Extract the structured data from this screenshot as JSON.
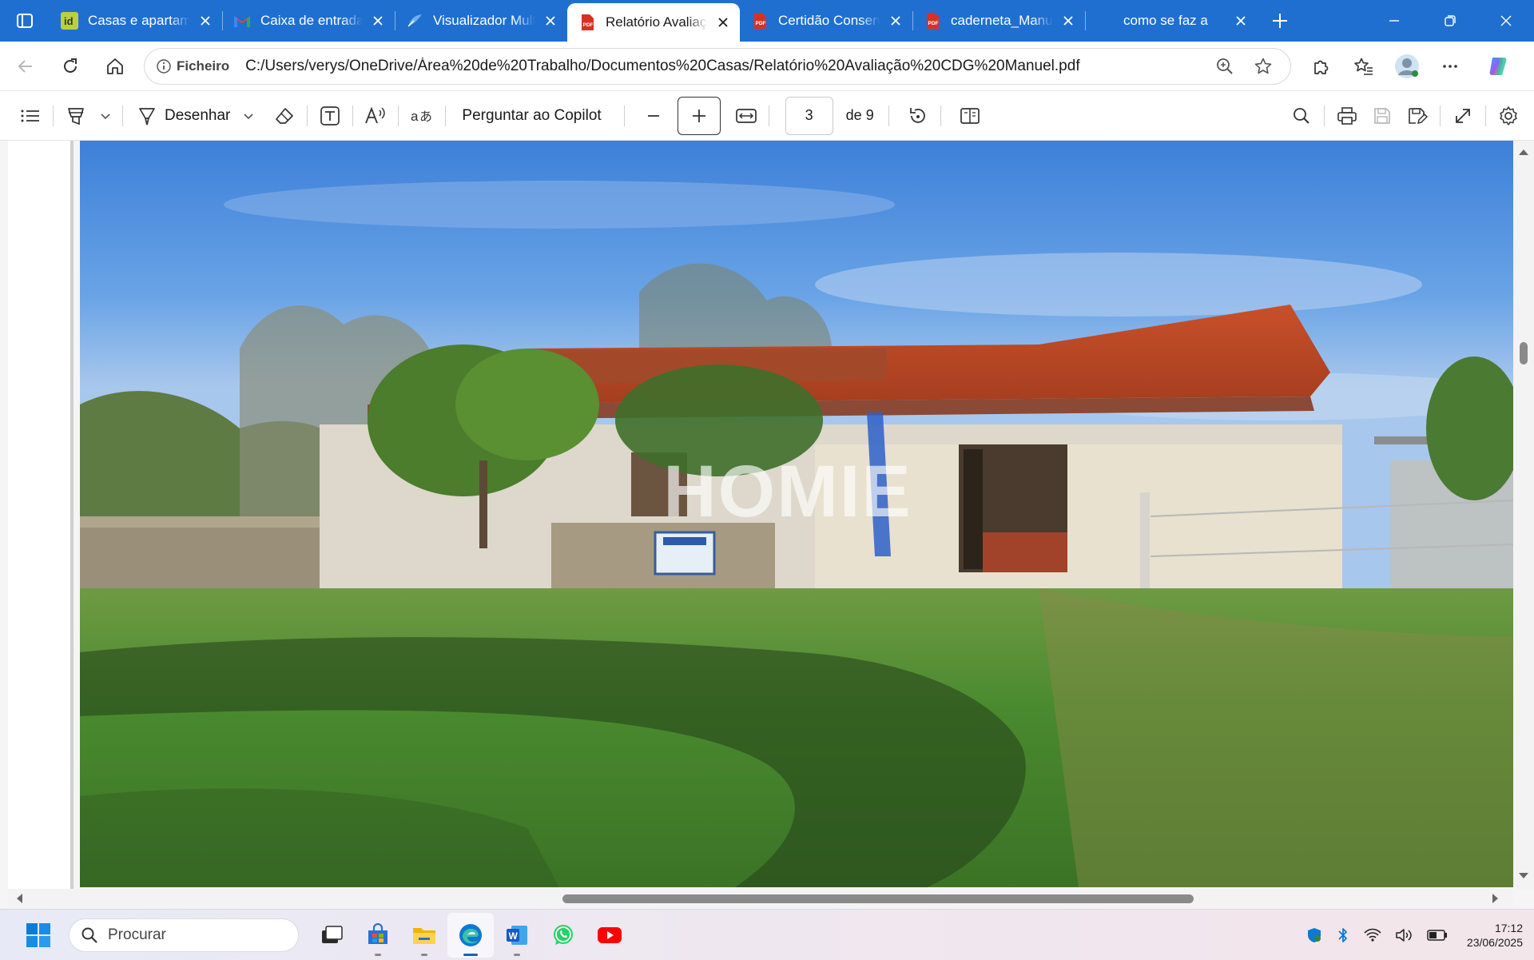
{
  "browser": {
    "tabs": [
      {
        "title": "Casas e apartamentos",
        "favicon": "idealista-icon",
        "active": false
      },
      {
        "title": "Caixa de entrada",
        "favicon": "gmail-icon",
        "active": false
      },
      {
        "title": "Visualizador Multimédia",
        "favicon": "viewer-icon",
        "active": false
      },
      {
        "title": "Relatório Avaliação",
        "favicon": "pdf-icon",
        "active": true
      },
      {
        "title": "Certidão Conservatória",
        "favicon": "pdf-icon",
        "active": false
      },
      {
        "title": "caderneta_Manuel",
        "favicon": "pdf-icon",
        "active": false
      },
      {
        "title": "como se faz a",
        "favicon": "none",
        "active": false
      }
    ],
    "site_chip_label": "Ficheiro",
    "url": "C:/Users/verys/OneDrive/Área%20de%20Trabalho/Documentos%20Casas/Relatório%20Avaliação%20CDG%20Manuel.pdf"
  },
  "pdf_toolbar": {
    "draw_label": "Desenhar",
    "copilot_label": "Perguntar ao Copilot",
    "current_page": "3",
    "page_total": "de 9"
  },
  "document": {
    "watermark_text": "HOMIE"
  },
  "taskbar": {
    "search_placeholder": "Procurar",
    "time": "17:12",
    "date": "23/06/2025"
  },
  "colors": {
    "tab_bar": "#1f6fd0",
    "pdf_red": "#d93025",
    "edge_blue": "#0f78d4"
  }
}
